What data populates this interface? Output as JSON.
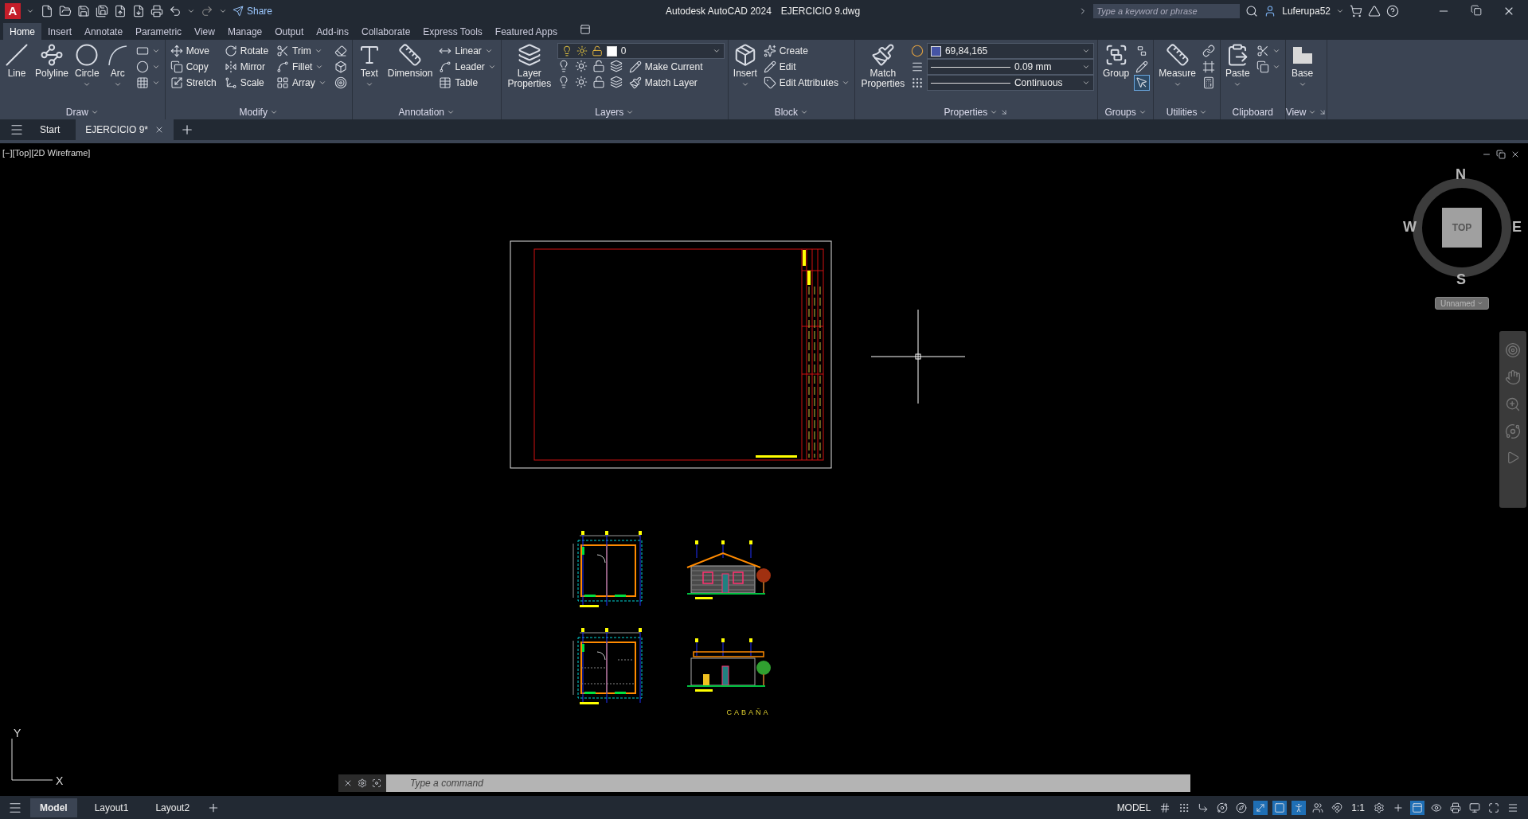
{
  "title_bar": {
    "logo": "A",
    "share": "Share",
    "app_name": "Autodesk AutoCAD 2024",
    "file_name": "EJERCICIO 9.dwg",
    "search": {
      "placeholder": "Type a keyword or phrase"
    },
    "user": "Luferupa52"
  },
  "ribbon_tabs": [
    {
      "label": "Home",
      "selected": true
    },
    {
      "label": "Insert",
      "selected": false
    },
    {
      "label": "Annotate",
      "selected": false
    },
    {
      "label": "Parametric",
      "selected": false
    },
    {
      "label": "View",
      "selected": false
    },
    {
      "label": "Manage",
      "selected": false
    },
    {
      "label": "Output",
      "selected": false
    },
    {
      "label": "Add-ins",
      "selected": false
    },
    {
      "label": "Collaborate",
      "selected": false
    },
    {
      "label": "Express Tools",
      "selected": false
    },
    {
      "label": "Featured Apps",
      "selected": false
    }
  ],
  "ribbon_panels": [
    {
      "title": "Draw",
      "title_menu": true,
      "launcher": false,
      "large": [
        {
          "label": "Line",
          "dropdown": false
        },
        {
          "label": "Polyline",
          "dropdown": false
        },
        {
          "label": "Circle",
          "dropdown": true
        },
        {
          "label": "Arc",
          "dropdown": true
        }
      ],
      "small": [
        {
          "dropdown": true
        },
        {
          "dropdown": true
        },
        {
          "dropdown": true
        }
      ]
    },
    {
      "title": "Modify",
      "title_menu": true,
      "launcher": false,
      "small": [
        {
          "label": "Move",
          "dropdown": false
        },
        {
          "label": "Copy",
          "dropdown": false
        },
        {
          "label": "Stretch",
          "dropdown": false
        },
        {
          "label": "Rotate",
          "dropdown": false
        },
        {
          "label": "Mirror",
          "dropdown": false
        },
        {
          "label": "Scale",
          "dropdown": false
        },
        {
          "label": "Trim",
          "dropdown": true
        },
        {
          "label": "Fillet",
          "dropdown": true
        },
        {
          "label": "Array",
          "dropdown": true
        },
        {
          "dropdown": false
        },
        {
          "dropdown": false
        },
        {
          "dropdown": false
        }
      ]
    },
    {
      "title": "Annotation",
      "title_menu": true,
      "launcher": false,
      "large": [
        {
          "label": "Text",
          "dropdown": true
        },
        {
          "label": "Dimension",
          "dropdown": false
        }
      ],
      "small": [
        {
          "label": "Linear",
          "dropdown": true
        },
        {
          "label": "Leader",
          "dropdown": true
        },
        {
          "label": "Table",
          "dropdown": false
        }
      ]
    },
    {
      "title": "Layers",
      "title_menu": true,
      "launcher": false,
      "large": [
        {
          "label": "Layer Properties",
          "dropdown": false
        }
      ],
      "combo": {
        "value": "0"
      },
      "small": [
        {
          "label": "Make Current",
          "dropdown": false
        },
        {
          "label": "Match Layer",
          "dropdown": false
        }
      ]
    },
    {
      "title": "Block",
      "title_menu": true,
      "launcher": false,
      "large": [
        {
          "label": "Insert",
          "dropdown": true
        }
      ],
      "small": [
        {
          "label": "Create",
          "dropdown": false
        },
        {
          "label": "Edit",
          "dropdown": false
        },
        {
          "label": "Edit Attributes",
          "dropdown": true
        }
      ]
    },
    {
      "title": "Properties",
      "title_menu": true,
      "launcher": true,
      "large": [
        {
          "label": "Match Properties",
          "dropdown": false
        }
      ],
      "combos": [
        {
          "kind": "color",
          "value": "69,84,165",
          "color": "#4554a5"
        },
        {
          "kind": "lineweight",
          "value": "0.09 mm"
        },
        {
          "kind": "linetype",
          "value": "Continuous"
        }
      ]
    },
    {
      "title": "Groups",
      "title_menu": true,
      "launcher": false,
      "large": [
        {
          "label": "Group",
          "dropdown": false
        }
      ],
      "small": [
        {
          "dropdown": false,
          "on": false
        },
        {
          "dropdown": false,
          "on": false
        },
        {
          "dropdown": false,
          "on": true
        }
      ]
    },
    {
      "title": "Utilities",
      "title_menu": true,
      "launcher": false,
      "large": [
        {
          "label": "Measure",
          "dropdown": true
        }
      ],
      "small": [
        {
          "dropdown": false
        },
        {
          "dropdown": false
        },
        {
          "dropdown": false
        }
      ]
    },
    {
      "title": "Clipboard",
      "title_menu": false,
      "launcher": false,
      "large": [
        {
          "label": "Paste",
          "dropdown": true
        }
      ],
      "small": [
        {
          "dropdown": true
        },
        {
          "dropdown": true
        }
      ]
    },
    {
      "title": "View",
      "title_menu": true,
      "launcher": true,
      "large": [
        {
          "label": "Base",
          "dropdown": true
        }
      ]
    }
  ],
  "file_tabs": [
    {
      "label": "Start",
      "selected": false,
      "closable": false
    },
    {
      "label": "EJERCICIO 9*",
      "selected": true,
      "closable": true
    }
  ],
  "viewport": {
    "label": "[−][Top][2D Wireframe]",
    "drawing_title": "CABAÑA",
    "ucs": {
      "x": "X",
      "y": "Y"
    }
  },
  "view_cube": {
    "north": "N",
    "south": "S",
    "west": "W",
    "east": "E",
    "face": "TOP",
    "ucs_menu": "Unnamed"
  },
  "command_line": {
    "placeholder": "Type a command"
  },
  "layout_tabs": [
    {
      "label": "Model",
      "selected": true
    },
    {
      "label": "Layout1",
      "selected": false
    },
    {
      "label": "Layout2",
      "selected": false
    }
  ],
  "status_bar": {
    "space": "MODEL",
    "toggles": [
      {
        "on": false
      },
      {
        "on": false
      },
      {
        "on": false
      },
      {
        "on": false
      },
      {
        "on": false
      },
      {
        "on": true
      },
      {
        "on": true
      }
    ],
    "annotation_toggles": [
      {
        "on": true
      },
      {
        "on": false
      },
      {
        "on": false
      }
    ],
    "scale": "1:1",
    "tools": [
      {
        "on": false
      },
      {
        "on": false
      },
      {
        "on": true
      },
      {
        "on": false
      },
      {
        "on": false
      },
      {
        "on": false
      },
      {
        "on": false
      },
      {
        "on": false
      }
    ]
  }
}
